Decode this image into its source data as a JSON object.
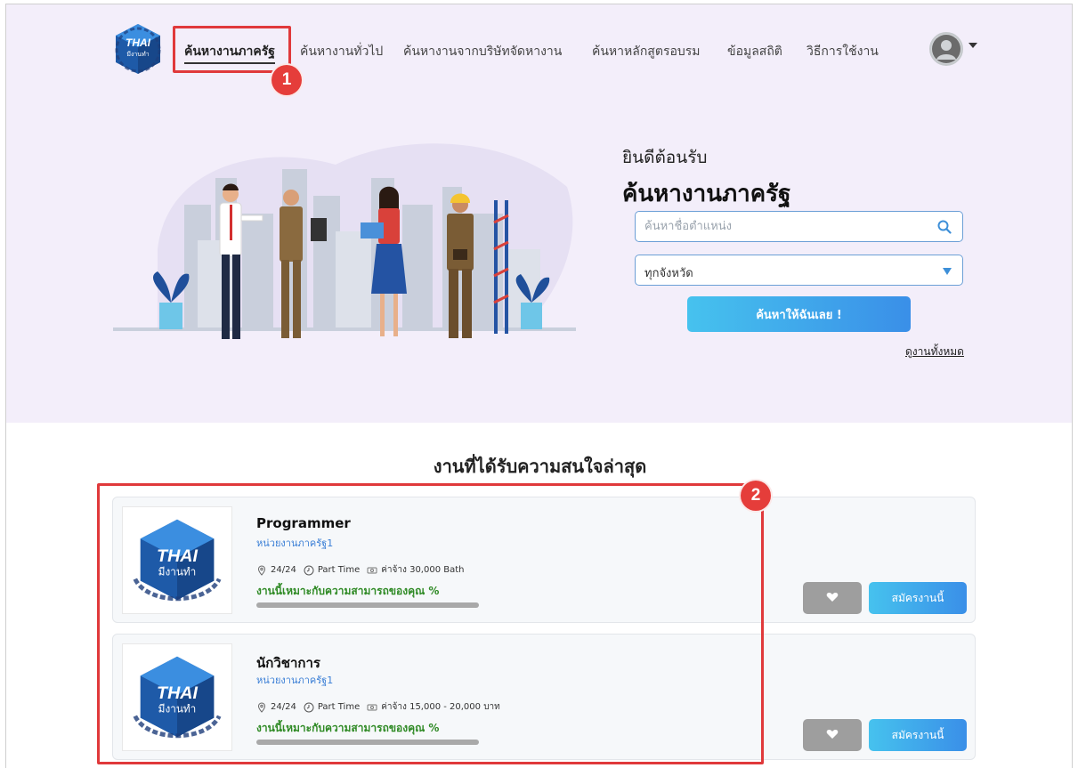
{
  "nav": {
    "logo": {
      "text_top": "THAI",
      "text_bottom": "มีงานทำ",
      "ring": "BETTER SKILLS BETTER JOBS"
    },
    "items": [
      {
        "label": "ค้นหางานภาครัฐ",
        "active": true
      },
      {
        "label": "ค้นหางานทั่วไป"
      },
      {
        "label": "ค้นหางานจากบริษัทจัดหางาน"
      },
      {
        "label": "ค้นหาหลักสูตรอบรม"
      },
      {
        "label": "ข้อมูลสถิติ"
      },
      {
        "label": "วิธีการใช้งาน"
      }
    ],
    "avatar_icon": "user-avatar-icon"
  },
  "hero": {
    "welcome": "ยินดีต้อนรับ",
    "title": "ค้นหางานภาครัฐ",
    "search_placeholder": "ค้นหาชื่อตำแหน่ง",
    "search_value": "",
    "province_selected": "ทุกจังหวัด",
    "search_button": "ค้นหาให้ฉันเลย !",
    "see_all": "ดูงานทั้งหมด"
  },
  "section": {
    "title": "งานที่ได้รับความสนใจล่าสุด"
  },
  "jobs": [
    {
      "title": "Programmer",
      "agency": "หน่วยงานภาครัฐ1",
      "slots": "24/24",
      "type": "Part Time",
      "salary": "ค่าจ้าง 30,000 Bath",
      "match": "งานนี้เหมาะกับความสามารถของคุณ %",
      "apply": "สมัครงานนี้"
    },
    {
      "title": "นักวิชาการ",
      "agency": "หน่วยงานภาครัฐ1",
      "slots": "24/24",
      "type": "Part Time",
      "salary": "ค่าจ้าง 15,000 - 20,000 บาท",
      "match": "งานนี้เหมาะกับความสามารถของคุณ %",
      "apply": "สมัครงานนี้"
    }
  ],
  "annotations": {
    "badge1": "1",
    "badge2": "2"
  },
  "colors": {
    "hero_bg": "#f3eefa",
    "accent_blue": "#3a8fe8",
    "annotation_red": "#e0393b",
    "match_green": "#2f8a25"
  }
}
